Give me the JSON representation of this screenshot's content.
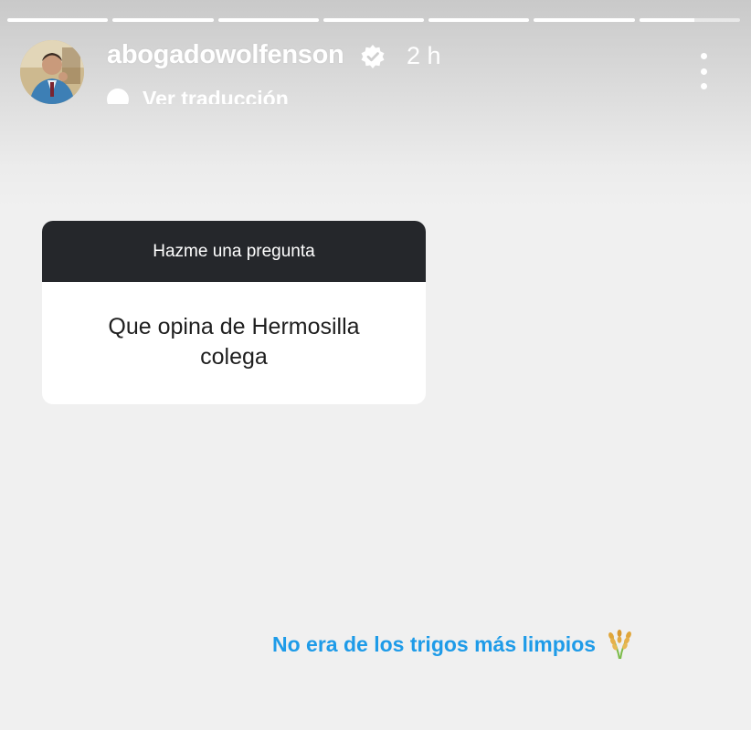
{
  "story": {
    "progress_segments": [
      1,
      1,
      1,
      1,
      1,
      1,
      0.55
    ],
    "username": "abogadowolfenson",
    "time": "2 h",
    "translate_label": "Ver traducción",
    "avatar_icon": "profile-photo",
    "verified_icon": "verified-badge",
    "more_icon": "more-options-icon"
  },
  "question_sticker": {
    "header": "Hazme una pregunta",
    "question": "Que opina de Hermosilla colega"
  },
  "caption": {
    "text": "No era de los trigos más limpios",
    "emoji_icon": "wheat-icon"
  },
  "colors": {
    "caption_blue": "#1e9be8",
    "sticker_header": "#25272b",
    "background": "#f0f0f0"
  }
}
